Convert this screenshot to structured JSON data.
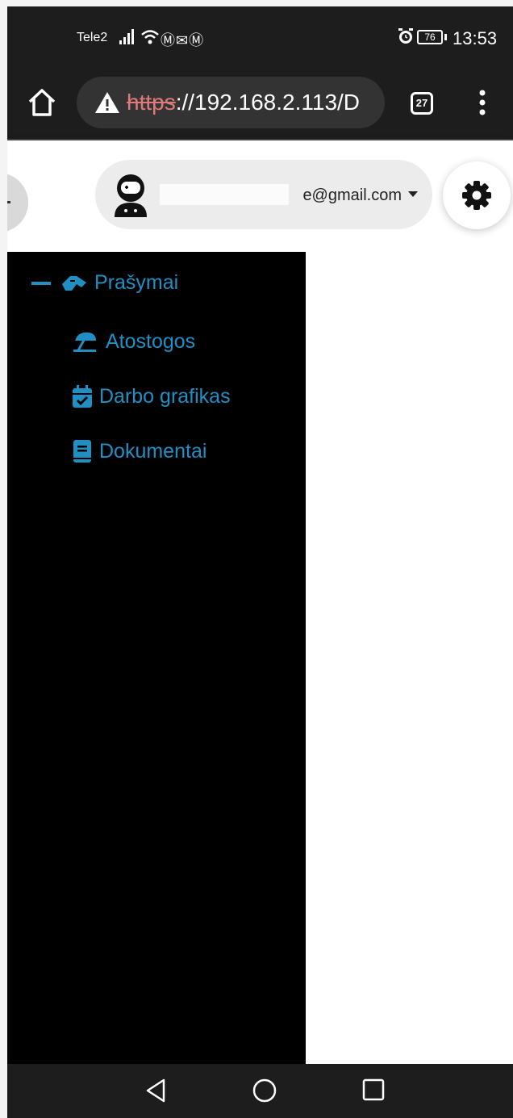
{
  "status_bar": {
    "carrier": "Tele2",
    "mail_icons": "Ⓜ✉Ⓜ",
    "battery": "76",
    "time": "13:53"
  },
  "browser": {
    "url_scheme": "https",
    "url_rest": "://192.168.2.113/D",
    "tab_count": "27"
  },
  "header": {
    "user_email": "e@gmail.com"
  },
  "sidebar": {
    "group_label": "Prašymai",
    "items": [
      {
        "label": "Atostogos",
        "icon": "umbrella-beach-icon"
      },
      {
        "label": "Darbo grafikas",
        "icon": "calendar-check-icon"
      },
      {
        "label": "Dokumentai",
        "icon": "book-icon"
      }
    ]
  },
  "colors": {
    "accent": "#1f8fc4",
    "sidebar_bg": "#000000",
    "bar_bg": "#1d1d1d"
  }
}
